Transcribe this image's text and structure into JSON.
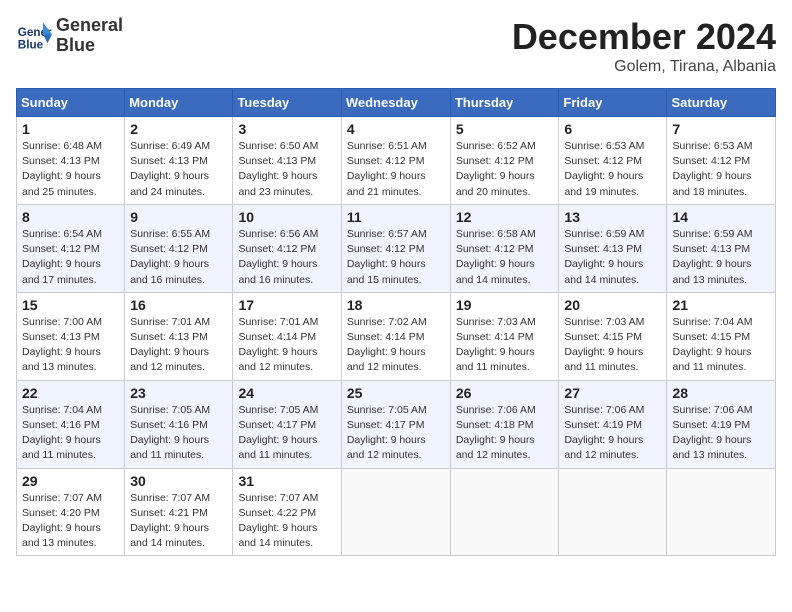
{
  "header": {
    "logo_line1": "General",
    "logo_line2": "Blue",
    "month_title": "December 2024",
    "location": "Golem, Tirana, Albania"
  },
  "weekdays": [
    "Sunday",
    "Monday",
    "Tuesday",
    "Wednesday",
    "Thursday",
    "Friday",
    "Saturday"
  ],
  "weeks": [
    [
      {
        "day": "1",
        "sunrise": "6:48 AM",
        "sunset": "4:13 PM",
        "daylight": "9 hours and 25 minutes."
      },
      {
        "day": "2",
        "sunrise": "6:49 AM",
        "sunset": "4:13 PM",
        "daylight": "9 hours and 24 minutes."
      },
      {
        "day": "3",
        "sunrise": "6:50 AM",
        "sunset": "4:13 PM",
        "daylight": "9 hours and 23 minutes."
      },
      {
        "day": "4",
        "sunrise": "6:51 AM",
        "sunset": "4:12 PM",
        "daylight": "9 hours and 21 minutes."
      },
      {
        "day": "5",
        "sunrise": "6:52 AM",
        "sunset": "4:12 PM",
        "daylight": "9 hours and 20 minutes."
      },
      {
        "day": "6",
        "sunrise": "6:53 AM",
        "sunset": "4:12 PM",
        "daylight": "9 hours and 19 minutes."
      },
      {
        "day": "7",
        "sunrise": "6:53 AM",
        "sunset": "4:12 PM",
        "daylight": "9 hours and 18 minutes."
      }
    ],
    [
      {
        "day": "8",
        "sunrise": "6:54 AM",
        "sunset": "4:12 PM",
        "daylight": "9 hours and 17 minutes."
      },
      {
        "day": "9",
        "sunrise": "6:55 AM",
        "sunset": "4:12 PM",
        "daylight": "9 hours and 16 minutes."
      },
      {
        "day": "10",
        "sunrise": "6:56 AM",
        "sunset": "4:12 PM",
        "daylight": "9 hours and 16 minutes."
      },
      {
        "day": "11",
        "sunrise": "6:57 AM",
        "sunset": "4:12 PM",
        "daylight": "9 hours and 15 minutes."
      },
      {
        "day": "12",
        "sunrise": "6:58 AM",
        "sunset": "4:12 PM",
        "daylight": "9 hours and 14 minutes."
      },
      {
        "day": "13",
        "sunrise": "6:59 AM",
        "sunset": "4:13 PM",
        "daylight": "9 hours and 14 minutes."
      },
      {
        "day": "14",
        "sunrise": "6:59 AM",
        "sunset": "4:13 PM",
        "daylight": "9 hours and 13 minutes."
      }
    ],
    [
      {
        "day": "15",
        "sunrise": "7:00 AM",
        "sunset": "4:13 PM",
        "daylight": "9 hours and 13 minutes."
      },
      {
        "day": "16",
        "sunrise": "7:01 AM",
        "sunset": "4:13 PM",
        "daylight": "9 hours and 12 minutes."
      },
      {
        "day": "17",
        "sunrise": "7:01 AM",
        "sunset": "4:14 PM",
        "daylight": "9 hours and 12 minutes."
      },
      {
        "day": "18",
        "sunrise": "7:02 AM",
        "sunset": "4:14 PM",
        "daylight": "9 hours and 12 minutes."
      },
      {
        "day": "19",
        "sunrise": "7:03 AM",
        "sunset": "4:14 PM",
        "daylight": "9 hours and 11 minutes."
      },
      {
        "day": "20",
        "sunrise": "7:03 AM",
        "sunset": "4:15 PM",
        "daylight": "9 hours and 11 minutes."
      },
      {
        "day": "21",
        "sunrise": "7:04 AM",
        "sunset": "4:15 PM",
        "daylight": "9 hours and 11 minutes."
      }
    ],
    [
      {
        "day": "22",
        "sunrise": "7:04 AM",
        "sunset": "4:16 PM",
        "daylight": "9 hours and 11 minutes."
      },
      {
        "day": "23",
        "sunrise": "7:05 AM",
        "sunset": "4:16 PM",
        "daylight": "9 hours and 11 minutes."
      },
      {
        "day": "24",
        "sunrise": "7:05 AM",
        "sunset": "4:17 PM",
        "daylight": "9 hours and 11 minutes."
      },
      {
        "day": "25",
        "sunrise": "7:05 AM",
        "sunset": "4:17 PM",
        "daylight": "9 hours and 12 minutes."
      },
      {
        "day": "26",
        "sunrise": "7:06 AM",
        "sunset": "4:18 PM",
        "daylight": "9 hours and 12 minutes."
      },
      {
        "day": "27",
        "sunrise": "7:06 AM",
        "sunset": "4:19 PM",
        "daylight": "9 hours and 12 minutes."
      },
      {
        "day": "28",
        "sunrise": "7:06 AM",
        "sunset": "4:19 PM",
        "daylight": "9 hours and 13 minutes."
      }
    ],
    [
      {
        "day": "29",
        "sunrise": "7:07 AM",
        "sunset": "4:20 PM",
        "daylight": "9 hours and 13 minutes."
      },
      {
        "day": "30",
        "sunrise": "7:07 AM",
        "sunset": "4:21 PM",
        "daylight": "9 hours and 14 minutes."
      },
      {
        "day": "31",
        "sunrise": "7:07 AM",
        "sunset": "4:22 PM",
        "daylight": "9 hours and 14 minutes."
      },
      null,
      null,
      null,
      null
    ]
  ],
  "labels": {
    "sunrise": "Sunrise:",
    "sunset": "Sunset:",
    "daylight": "Daylight:"
  }
}
